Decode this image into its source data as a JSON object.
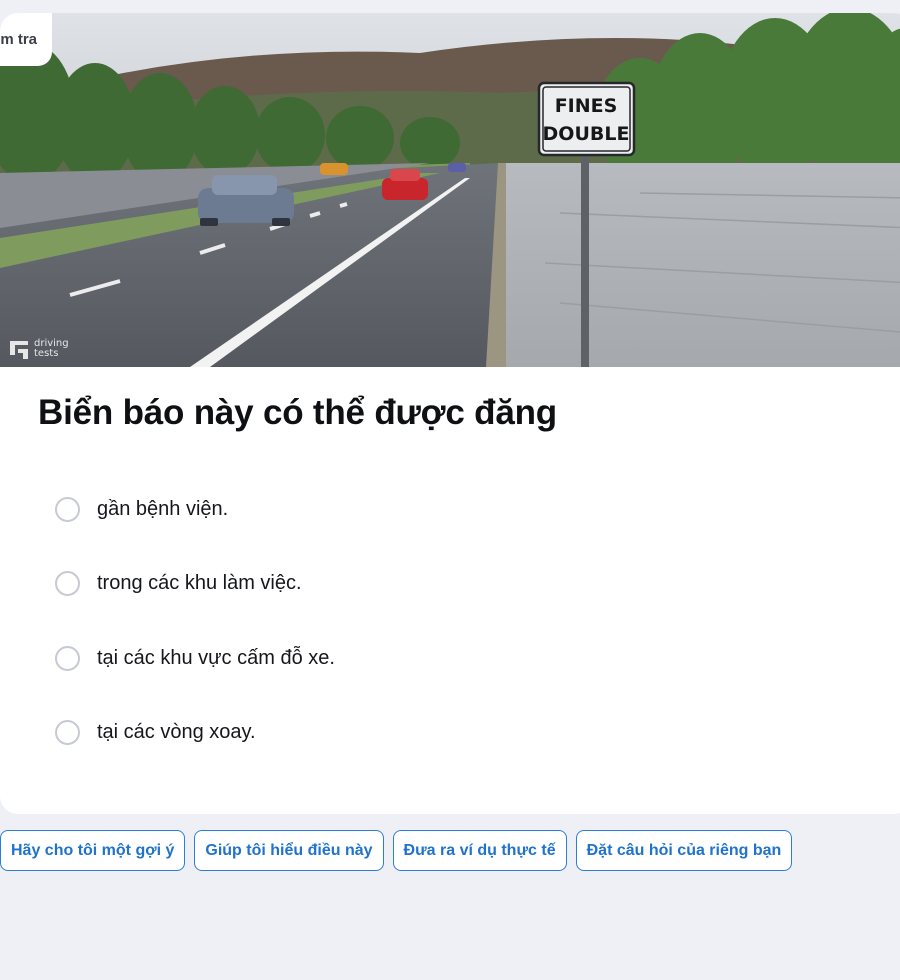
{
  "header": {
    "tag_label": "m tra"
  },
  "image": {
    "sign_line1": "FINES",
    "sign_line2": "DOUBLE",
    "watermark_line1": "driving",
    "watermark_line2": "tests"
  },
  "question": {
    "text": "Biển báo này có thể được đăng",
    "options": [
      {
        "label": "gần bệnh viện."
      },
      {
        "label": "trong các khu làm việc."
      },
      {
        "label": "tại các khu vực cấm đỗ xe."
      },
      {
        "label": "tại các vòng xoay."
      }
    ]
  },
  "help_chips": [
    {
      "label": "Hãy cho tôi một gợi ý"
    },
    {
      "label": "Giúp tôi hiểu điều này"
    },
    {
      "label": "Đưa ra ví dụ thực tế"
    },
    {
      "label": "Đặt câu hỏi của riêng bạn"
    }
  ],
  "colors": {
    "accent": "#1f73cc",
    "page_bg": "#eff0f5"
  }
}
